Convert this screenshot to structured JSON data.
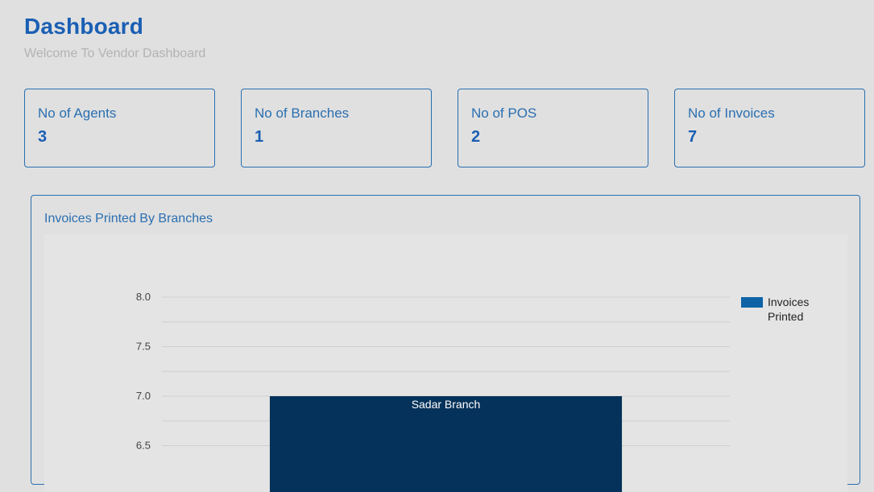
{
  "header": {
    "title": "Dashboard",
    "subtitle": "Welcome To Vendor Dashboard"
  },
  "stats": [
    {
      "label": "No of Agents",
      "value": "3"
    },
    {
      "label": "No of Branches",
      "value": "1"
    },
    {
      "label": "No of POS",
      "value": "2"
    },
    {
      "label": "No of Invoices",
      "value": "7"
    }
  ],
  "chart": {
    "title": "Invoices Printed By Branches"
  },
  "colors": {
    "accent": "#1a5fb4",
    "border": "#2a6fb0",
    "bar": "#05325a",
    "legend_swatch": "#0e63a6",
    "gridline": "#cfcfcf"
  },
  "chart_data": {
    "type": "bar",
    "categories": [
      "Sadar Branch"
    ],
    "series": [
      {
        "name": "Invoices Printed",
        "values": [
          7
        ]
      }
    ],
    "ylim": [
      6.3,
      8.0
    ],
    "yticks": [
      "8.0",
      "7.5",
      "7.0",
      "6.5"
    ],
    "grid": true,
    "legend": "top-right",
    "category_label_position": "inside-top"
  }
}
